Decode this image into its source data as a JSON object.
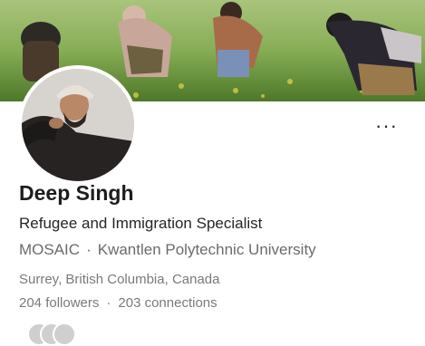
{
  "profile": {
    "name": "Deep Singh",
    "headline": "Refugee and Immigration Specialist",
    "organization": "MOSAIC",
    "separator": "·",
    "school": "Kwantlen Polytechnic University",
    "location": "Surrey, British Columbia, Canada",
    "followers": "204 followers",
    "connections": "203 connections"
  },
  "actions": {
    "more_label": "···"
  },
  "colors": {
    "name": "#1d1d1d",
    "secondary_text": "#6b6b6b",
    "banner_green": "#8eb563"
  },
  "icons": {
    "more": "more-options-icon"
  }
}
